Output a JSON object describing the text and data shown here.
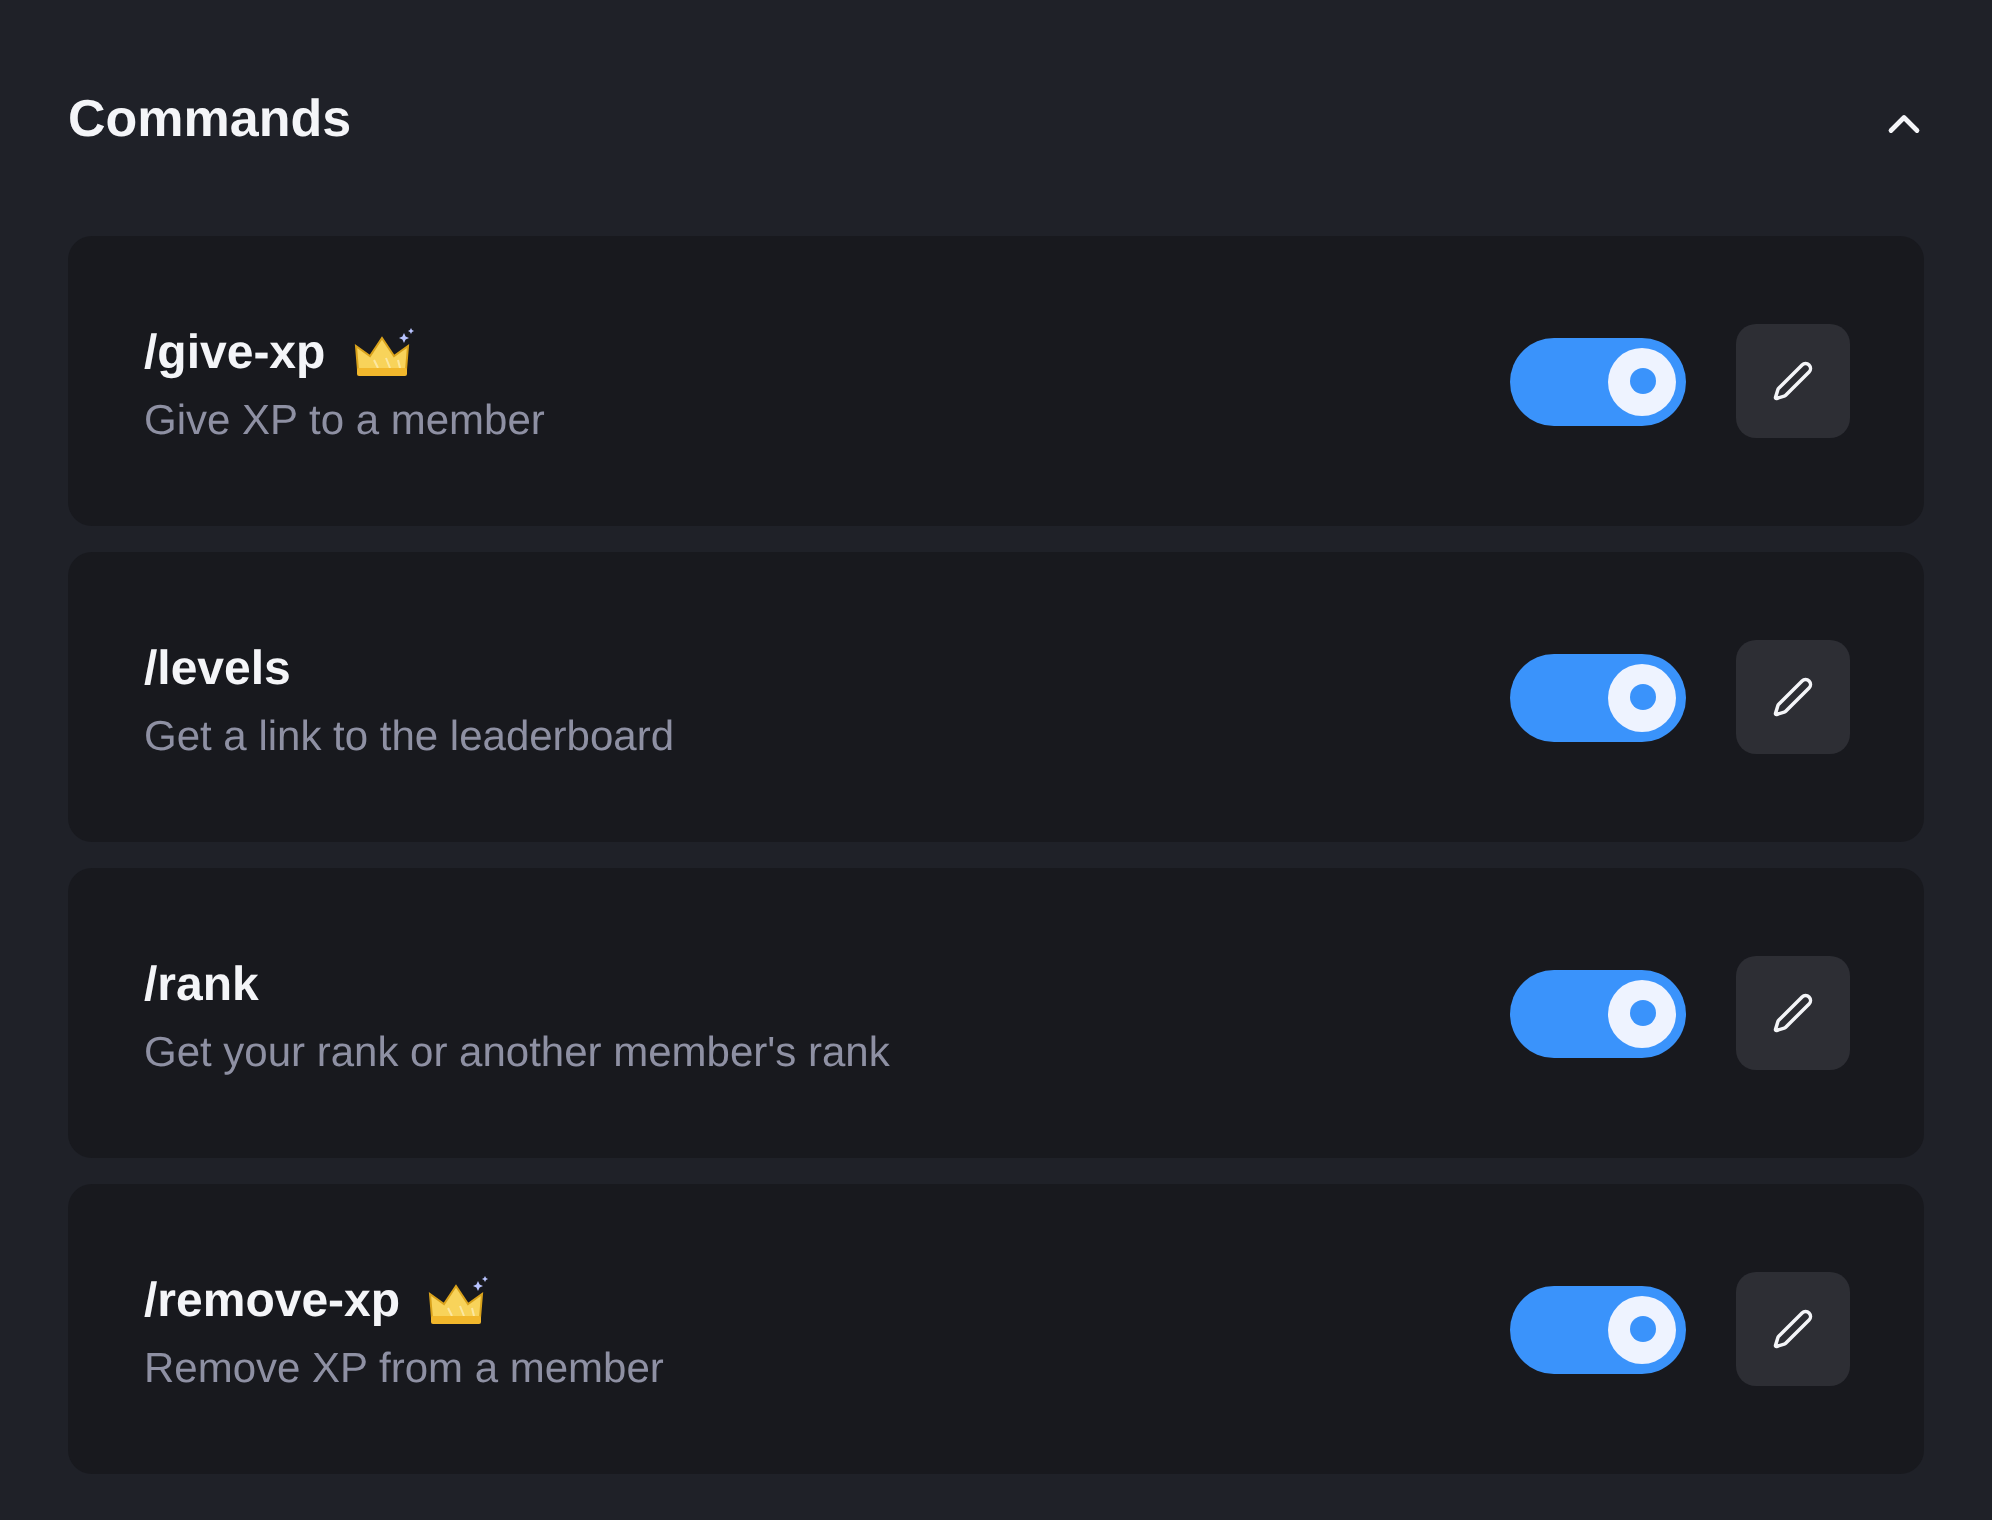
{
  "section": {
    "title": "Commands",
    "expanded": true
  },
  "commands": [
    {
      "name": "/give-xp",
      "premium": true,
      "description": "Give XP to a member",
      "enabled": true
    },
    {
      "name": "/levels",
      "premium": false,
      "description": "Get a link to the leaderboard",
      "enabled": true
    },
    {
      "name": "/rank",
      "premium": false,
      "description": "Get your rank or another member's rank",
      "enabled": true
    },
    {
      "name": "/remove-xp",
      "premium": true,
      "description": "Remove XP from a member",
      "enabled": true
    }
  ]
}
